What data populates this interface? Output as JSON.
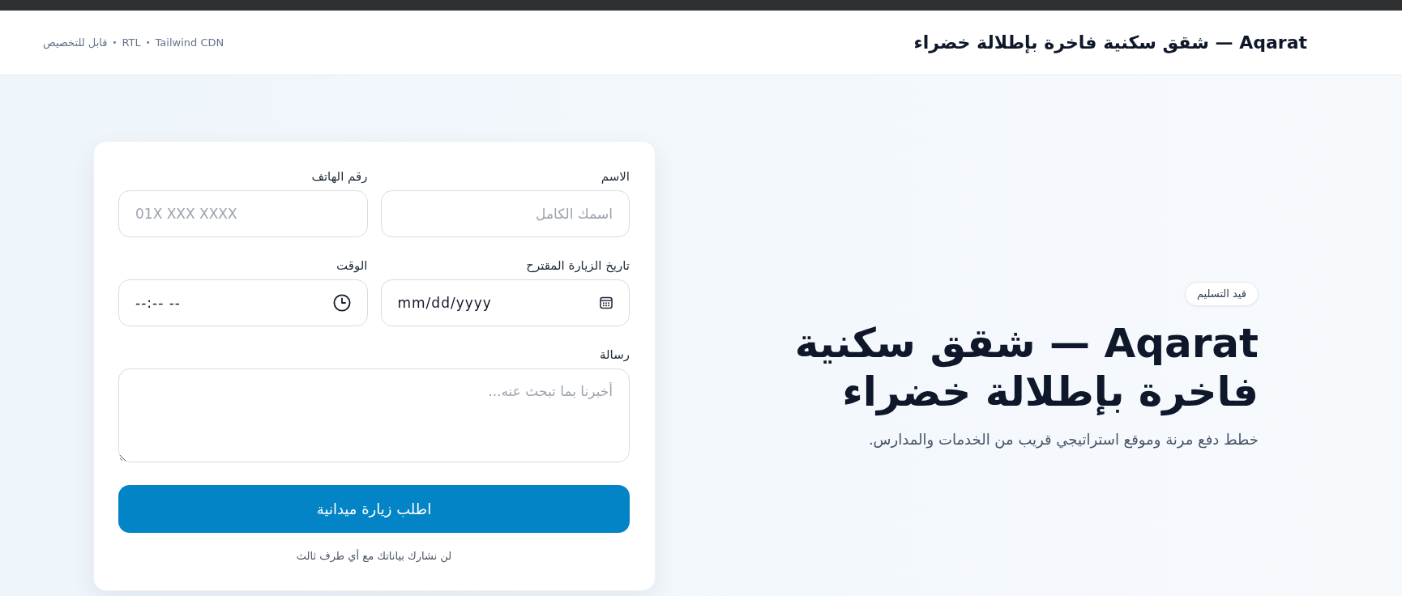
{
  "header": {
    "title": "Aqarat — شقق سكنية فاخرة بإطلالة خضراء",
    "tags": [
      "Tailwind CDN",
      "RTL",
      "قابل للتخصيص"
    ],
    "separator": "•"
  },
  "hero": {
    "badge": "قيد التسليم",
    "title": "Aqarat — شقق سكنية فاخرة بإطلالة خضراء",
    "subtitle": "خطط دفع مرنة وموقع استراتيجي قريب من الخدمات والمدارس."
  },
  "form": {
    "fields": [
      {
        "kind": "text",
        "label": "الاسم",
        "placeholder": "اسمك الكامل"
      },
      {
        "kind": "phone",
        "label": "رقم الهاتف",
        "placeholder": "01X XXX XXXX"
      },
      {
        "kind": "date",
        "label": "تاريخ الزيارة المقترح",
        "placeholder": "mm/dd/yyyy"
      },
      {
        "kind": "time",
        "label": "الوقت",
        "placeholder": "--:-- --"
      },
      {
        "kind": "textarea",
        "label": "رسالة",
        "placeholder": "أخبرنا بما تبحث عنه..."
      }
    ],
    "submit": "اطلب زيارة ميدانية",
    "note": "لن نشارك بياناتك مع أي طرف ثالث"
  }
}
